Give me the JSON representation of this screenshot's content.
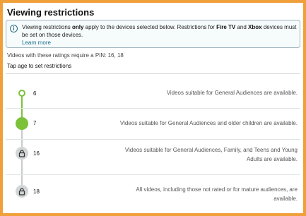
{
  "title": "Viewing restrictions",
  "info": {
    "part1": "Viewing restrictions ",
    "bold1": "only",
    "part2": " apply to the devices selected below. Restrictions for ",
    "bold2": "Fire TV",
    "part3": " and ",
    "bold3": "Xbox",
    "part4": " devices must be set on those devices.",
    "learn_more": "Learn more",
    "icon": "info-icon"
  },
  "pin_note": "Videos with these ratings require a PIN: 16, 18",
  "tap_note": "Tap age to set restrictions",
  "ratings": [
    {
      "age": "6",
      "description": "Videos suitable for General Audiences are available.",
      "state": "open"
    },
    {
      "age": "7",
      "description": "Videos suitable for General Audiences and older children are available.",
      "state": "selected"
    },
    {
      "age": "16",
      "description": "Videos suitable for General Audiences, Family, and Teens and Young Adults are available.",
      "state": "locked"
    },
    {
      "age": "18",
      "description": "All videos, including those not rated or for mature audiences, are available.",
      "state": "locked"
    }
  ],
  "colors": {
    "accent": "#7cc13a",
    "border": "#f0a03a",
    "link": "#1a6d8c"
  }
}
